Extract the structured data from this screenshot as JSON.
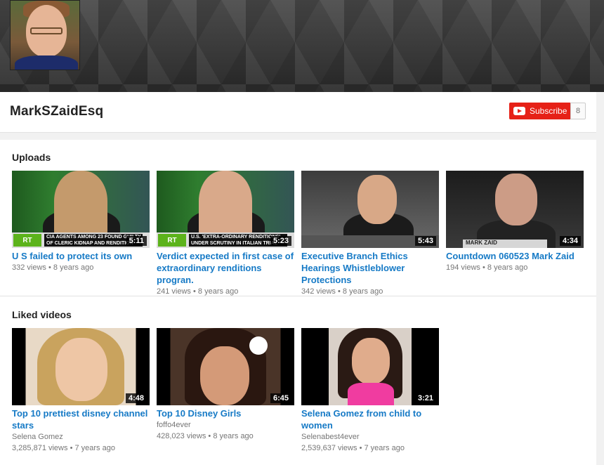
{
  "channel": {
    "name": "MarkSZaidEsq",
    "subscribe_label": "Subscribe",
    "subscriber_count": "8"
  },
  "uploads": {
    "title": "Uploads",
    "items": [
      {
        "title": "U S failed to protect its own",
        "views": "332 views",
        "age": "8 years ago",
        "duration": "5:11",
        "overlay": "CIA AGENTS AMONG 23 FOUND GUILTY OF CLERIC KIDNAP AND RENDITION"
      },
      {
        "title": "Verdict expected in first case of extraordinary renditions progran.",
        "views": "241 views",
        "age": "8 years ago",
        "duration": "5:23",
        "overlay": "U.S. 'EXTRA-ORDINARY RENDITIONS' UNDER SCRUTINY IN ITALIAN TRIAL"
      },
      {
        "title": "Executive Branch Ethics Hearings Whistleblower Protections",
        "views": "342 views",
        "age": "8 years ago",
        "duration": "5:43"
      },
      {
        "title": "Countdown 060523 Mark Zaid",
        "views": "194 views",
        "age": "8 years ago",
        "duration": "4:34",
        "overlay": "MARK ZAID"
      }
    ]
  },
  "liked": {
    "title": "Liked videos",
    "items": [
      {
        "title": "Top 10 prettiest disney channel stars",
        "channel": "Selena Gomez",
        "views": "3,285,871 views",
        "age": "7 years ago",
        "duration": "4:48"
      },
      {
        "title": "Top 10 Disney Girls",
        "channel": "foffo4ever",
        "views": "428,023 views",
        "age": "8 years ago",
        "duration": "6:45"
      },
      {
        "title": "Selena Gomez from child to women",
        "channel": "Selenabest4ever",
        "views": "2,539,637 views",
        "age": "7 years ago",
        "duration": "3:21"
      }
    ]
  },
  "colors": {
    "link": "#167ac6",
    "subscribe": "#e62117",
    "rt_green": "#5cb31b"
  }
}
